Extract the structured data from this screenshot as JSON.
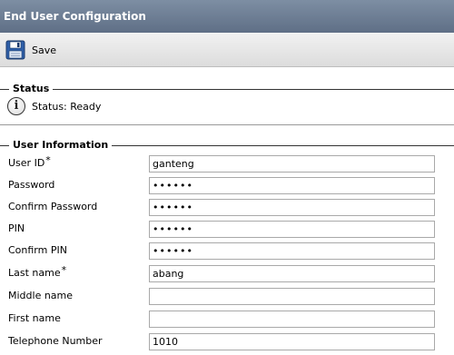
{
  "window": {
    "title": "End User Configuration"
  },
  "toolbar": {
    "save_label": "Save",
    "save_icon": "floppy-disk-icon"
  },
  "status_section": {
    "title": "Status",
    "icon": "info-icon",
    "icon_glyph": "i",
    "text": "Status: Ready"
  },
  "user_info": {
    "title": "User Information",
    "required_marker": "*",
    "fields": [
      {
        "label": "User ID",
        "value": "ganteng",
        "required": true,
        "type": "text"
      },
      {
        "label": "Password",
        "value": "123456",
        "required": false,
        "type": "password"
      },
      {
        "label": "Confirm Password",
        "value": "123456",
        "required": false,
        "type": "password"
      },
      {
        "label": "PIN",
        "value": "123456",
        "required": false,
        "type": "password"
      },
      {
        "label": "Confirm PIN",
        "value": "123456",
        "required": false,
        "type": "password"
      },
      {
        "label": "Last name",
        "value": "abang",
        "required": true,
        "type": "text"
      },
      {
        "label": "Middle name",
        "value": "",
        "required": false,
        "type": "text"
      },
      {
        "label": "First name",
        "value": "",
        "required": false,
        "type": "text"
      },
      {
        "label": "Telephone Number",
        "value": "1010",
        "required": false,
        "type": "text"
      }
    ]
  }
}
